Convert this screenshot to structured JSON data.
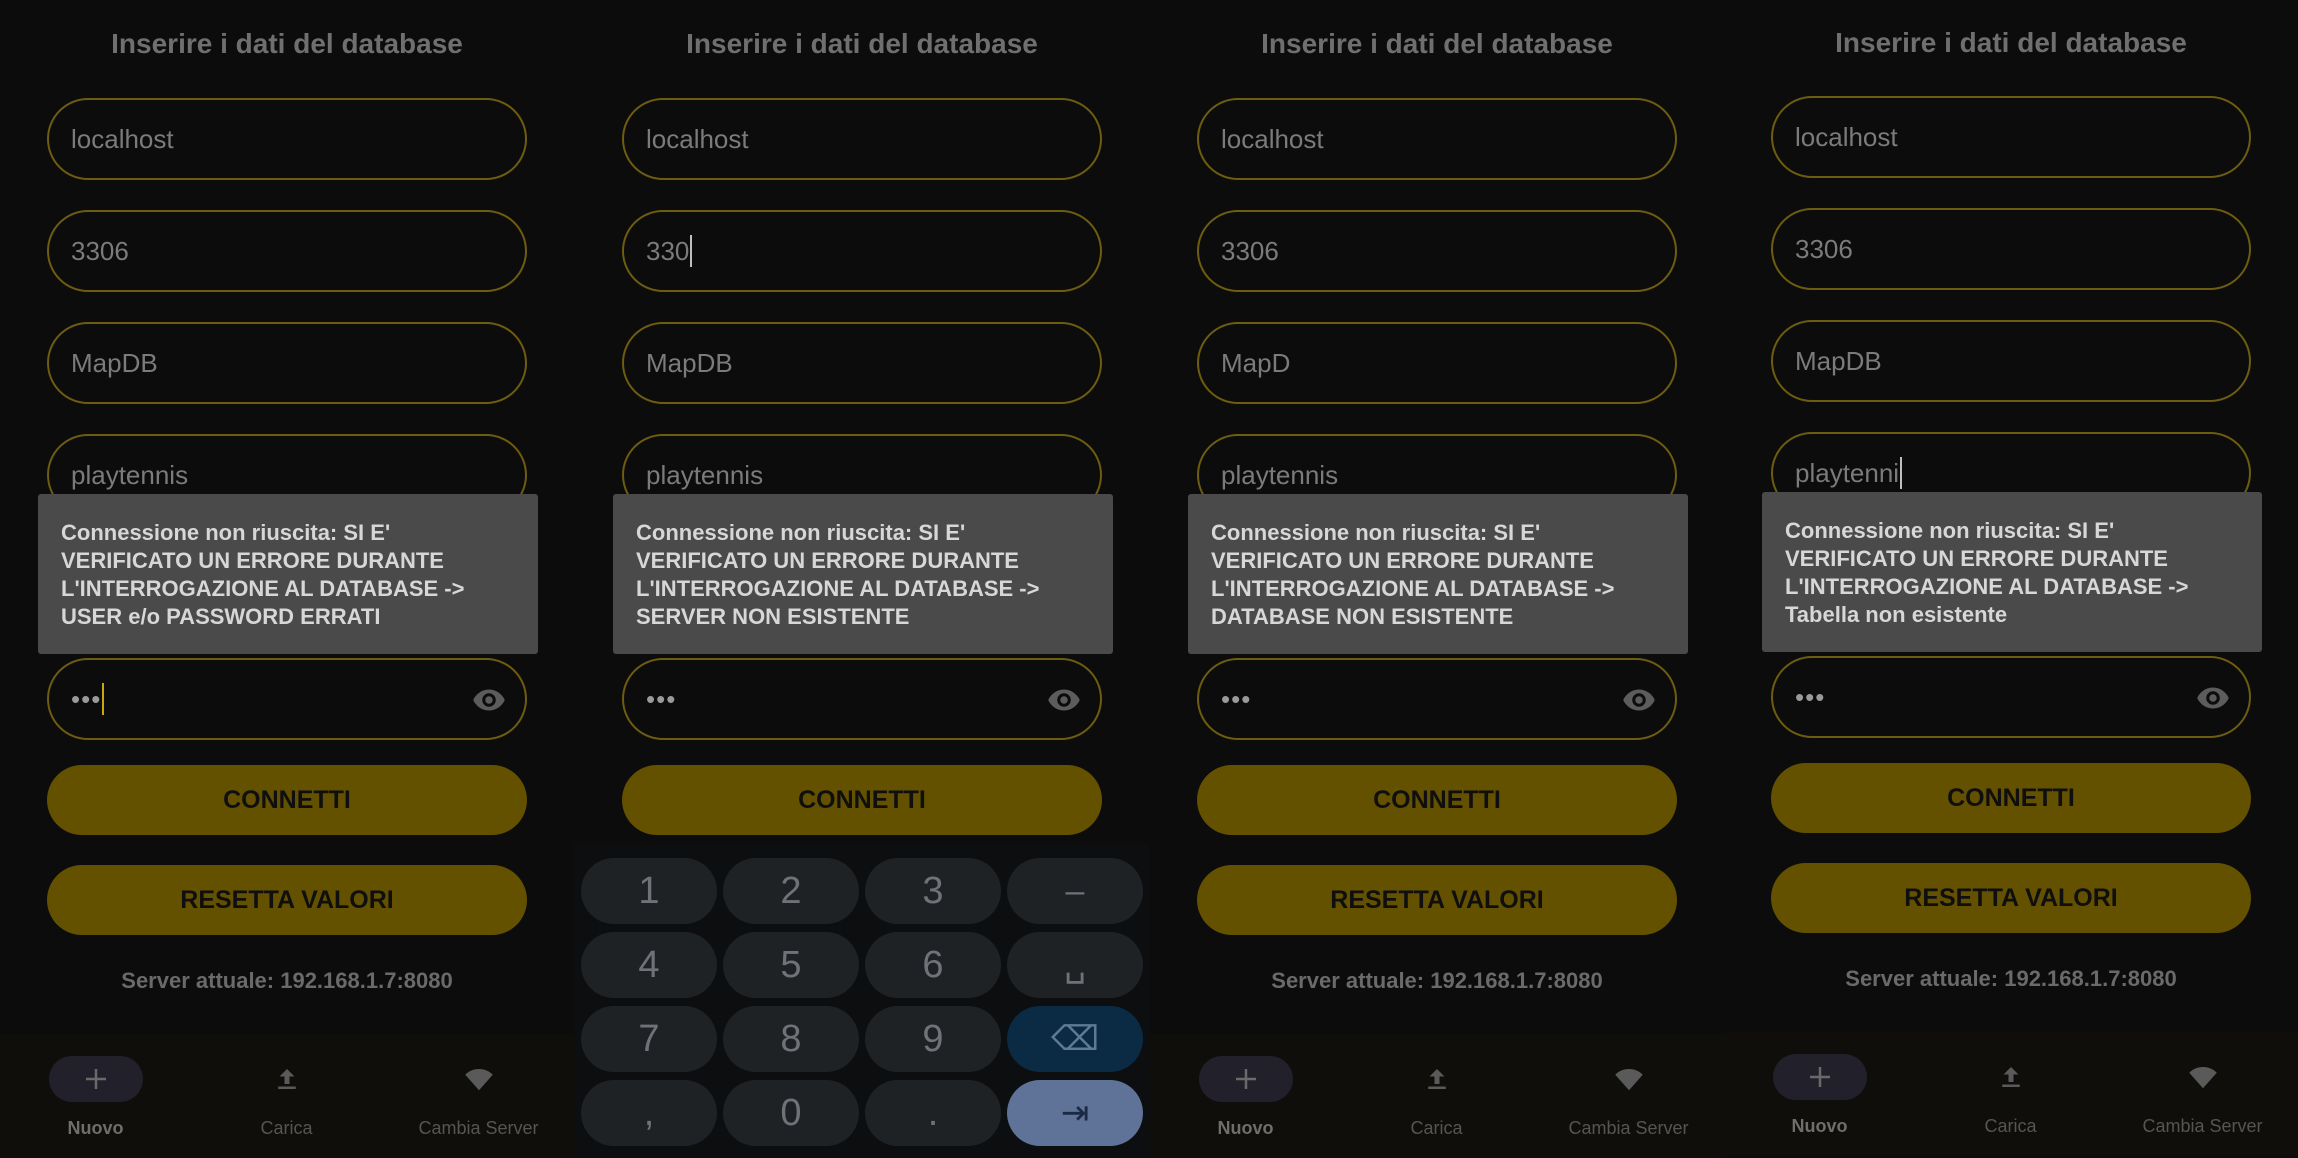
{
  "screen_title": "Inserire i dati del database",
  "connect_label": "CONNETTI",
  "reset_label": "RESETTA VALORI",
  "server_text": "Server attuale: 192.168.1.7:8080",
  "password_mask": "•••",
  "nav": {
    "new_label": "Nuovo",
    "load_label": "Carica",
    "server_label": "Cambia Server"
  },
  "panels": [
    {
      "host": "localhost",
      "port": "3306",
      "database": "MapDB",
      "table": "playtennis",
      "toast": "Connessione non riuscita: SI E'\nVERIFICATO UN ERRORE DURANTE\nL'INTERROGAZIONE AL DATABASE ->\nUSER e/o PASSWORD ERRATI"
    },
    {
      "host": "localhost",
      "port": "330",
      "database": "MapDB",
      "table": "playtennis",
      "toast": "Connessione non riuscita: SI E'\nVERIFICATO UN ERRORE DURANTE\nL'INTERROGAZIONE AL DATABASE ->\nSERVER NON ESISTENTE"
    },
    {
      "host": "localhost",
      "port": "3306",
      "database": "MapD",
      "table": "playtennis",
      "toast": "Connessione non riuscita: SI E'\nVERIFICATO UN ERRORE DURANTE\nL'INTERROGAZIONE AL DATABASE ->\nDATABASE NON ESISTENTE"
    },
    {
      "host": "localhost",
      "port": "3306",
      "database": "MapDB",
      "table": "playtenni",
      "toast": "Connessione non riuscita: SI E'\nVERIFICATO UN ERRORE DURANTE\nL'INTERROGAZIONE AL DATABASE ->\nTabella non esistente"
    }
  ],
  "keypad": {
    "keys": [
      "1",
      "2",
      "3",
      "–",
      "4",
      "5",
      "6",
      "␣",
      "7",
      "8",
      "9",
      "⌫",
      ",",
      "0",
      ".",
      "⇥"
    ]
  }
}
